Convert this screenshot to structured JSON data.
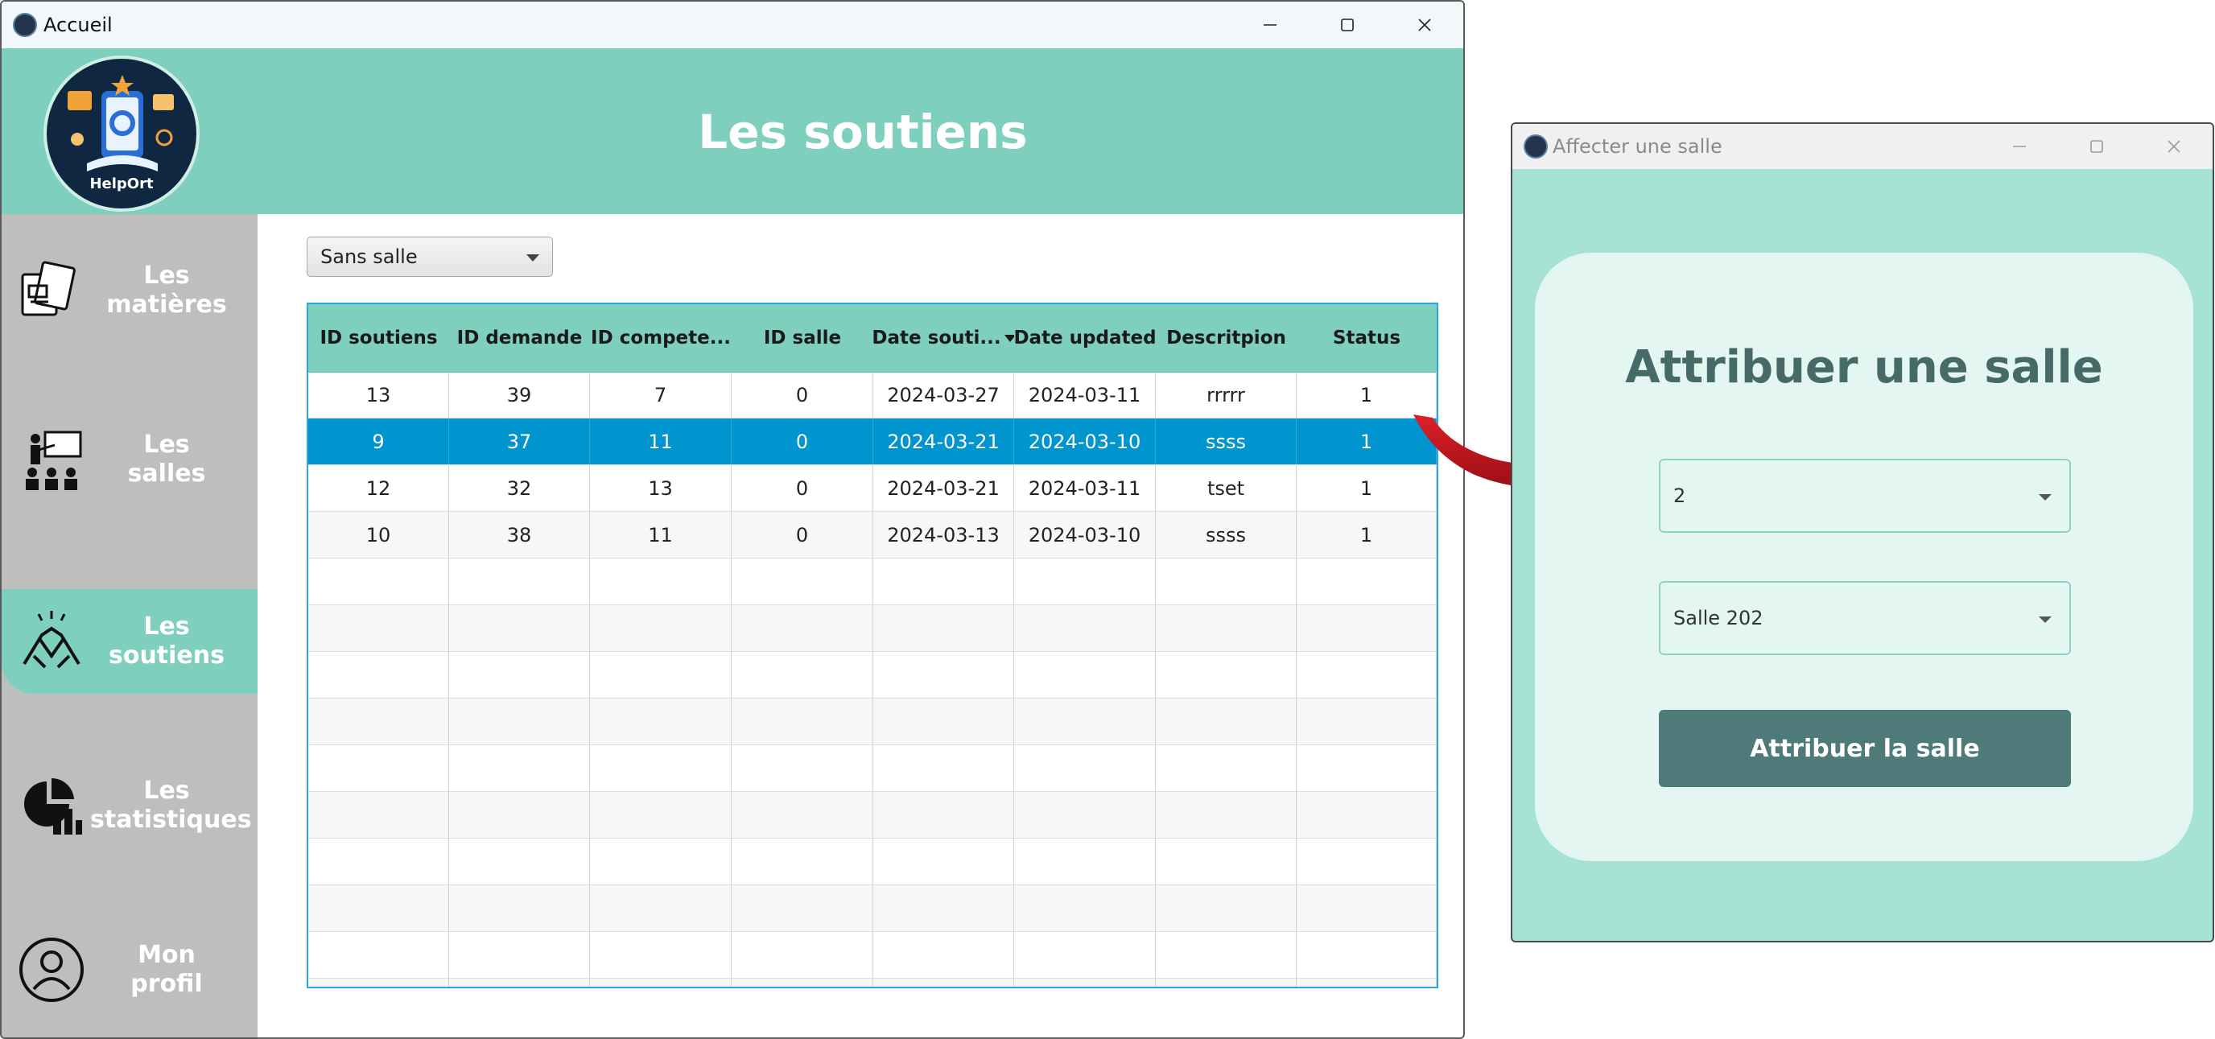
{
  "main_window": {
    "title": "Accueil",
    "header_title": "Les soutiens",
    "logo_text": "HelpOrt"
  },
  "sidebar": {
    "items": [
      {
        "label": "Les\nmatières",
        "icon": "books-icon",
        "active": false
      },
      {
        "label": "Les\nsalles",
        "icon": "classroom-icon",
        "active": false
      },
      {
        "label": "Les\nsoutiens",
        "icon": "handshake-icon",
        "active": true
      },
      {
        "label": "Les\nstatistiques",
        "icon": "chart-pie-icon",
        "active": false
      },
      {
        "label": "Mon\nprofil",
        "icon": "user-icon",
        "active": false
      }
    ]
  },
  "filter": {
    "selected": "Sans salle"
  },
  "table": {
    "columns": [
      "ID soutiens",
      "ID demande",
      "ID compete...",
      "ID salle",
      "Date souti...",
      "Date updated",
      "Descritpion",
      "Status"
    ],
    "sorted_column_index": 4,
    "rows": [
      [
        "13",
        "39",
        "7",
        "0",
        "2024-03-27",
        "2024-03-11",
        "rrrrr",
        "1"
      ],
      [
        "9",
        "37",
        "11",
        "0",
        "2024-03-21",
        "2024-03-10",
        "ssss",
        "1"
      ],
      [
        "12",
        "32",
        "13",
        "0",
        "2024-03-21",
        "2024-03-11",
        "tset",
        "1"
      ],
      [
        "10",
        "38",
        "11",
        "0",
        "2024-03-13",
        "2024-03-10",
        "ssss",
        "1"
      ]
    ],
    "selected_row_index": 1,
    "empty_rows": 10
  },
  "dialog": {
    "title": "Affecter une salle",
    "heading": "Attribuer une salle",
    "select_1_value": "2",
    "select_2_value": "Salle 202",
    "button_label": "Attribuer la salle"
  },
  "colors": {
    "accent_teal": "#7ecfbd",
    "selection_blue": "#0095cf",
    "dialog_bg": "#a6e3d5",
    "button": "#4f7a7a",
    "arrow": "#c8101a"
  }
}
